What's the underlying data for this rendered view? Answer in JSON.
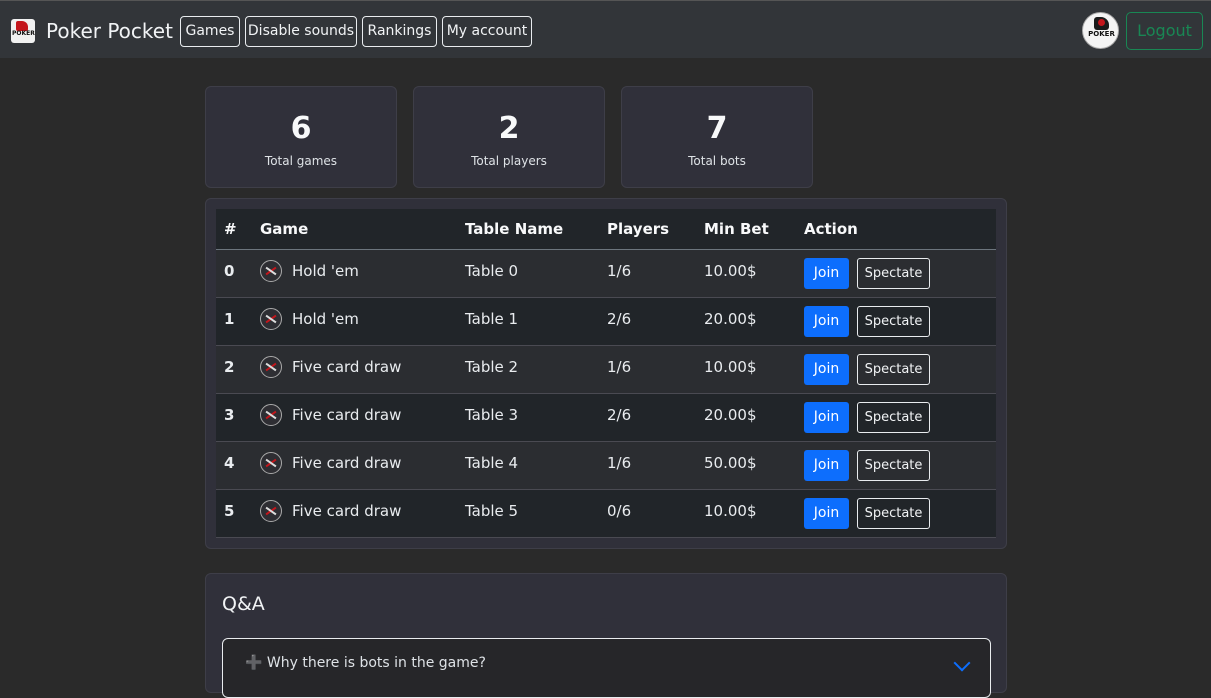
{
  "navbar": {
    "brand_name": "Poker Pocket",
    "logo_text": "POKER POCKET",
    "buttons": [
      "Games",
      "Disable sounds",
      "Rankings",
      "My account"
    ],
    "logout_label": "Logout",
    "logout_color": "#198754"
  },
  "stats": [
    {
      "value": "6",
      "label": "Total games"
    },
    {
      "value": "2",
      "label": "Total players"
    },
    {
      "value": "7",
      "label": "Total bots"
    }
  ],
  "table": {
    "headers": [
      "#",
      "Game",
      "Table Name",
      "Players",
      "Min Bet",
      "Action"
    ],
    "join_label": "Join",
    "spectate_label": "Spectate",
    "rows": [
      {
        "num": "0",
        "game": "Hold 'em",
        "table_name": "Table 0",
        "players": "1/6",
        "min_bet": "10.00$"
      },
      {
        "num": "1",
        "game": "Hold 'em",
        "table_name": "Table 1",
        "players": "2/6",
        "min_bet": "20.00$"
      },
      {
        "num": "2",
        "game": "Five card draw",
        "table_name": "Table 2",
        "players": "1/6",
        "min_bet": "10.00$"
      },
      {
        "num": "3",
        "game": "Five card draw",
        "table_name": "Table 3",
        "players": "2/6",
        "min_bet": "20.00$"
      },
      {
        "num": "4",
        "game": "Five card draw",
        "table_name": "Table 4",
        "players": "1/6",
        "min_bet": "50.00$"
      },
      {
        "num": "5",
        "game": "Five card draw",
        "table_name": "Table 5",
        "players": "0/6",
        "min_bet": "10.00$"
      }
    ]
  },
  "qa": {
    "title": "Q&A",
    "items": [
      {
        "question": "➕ Why there is bots in the game?"
      }
    ]
  },
  "colors": {
    "join_blue": "#0d6efd",
    "background": "#2a2a2a",
    "card": "#30303a"
  }
}
